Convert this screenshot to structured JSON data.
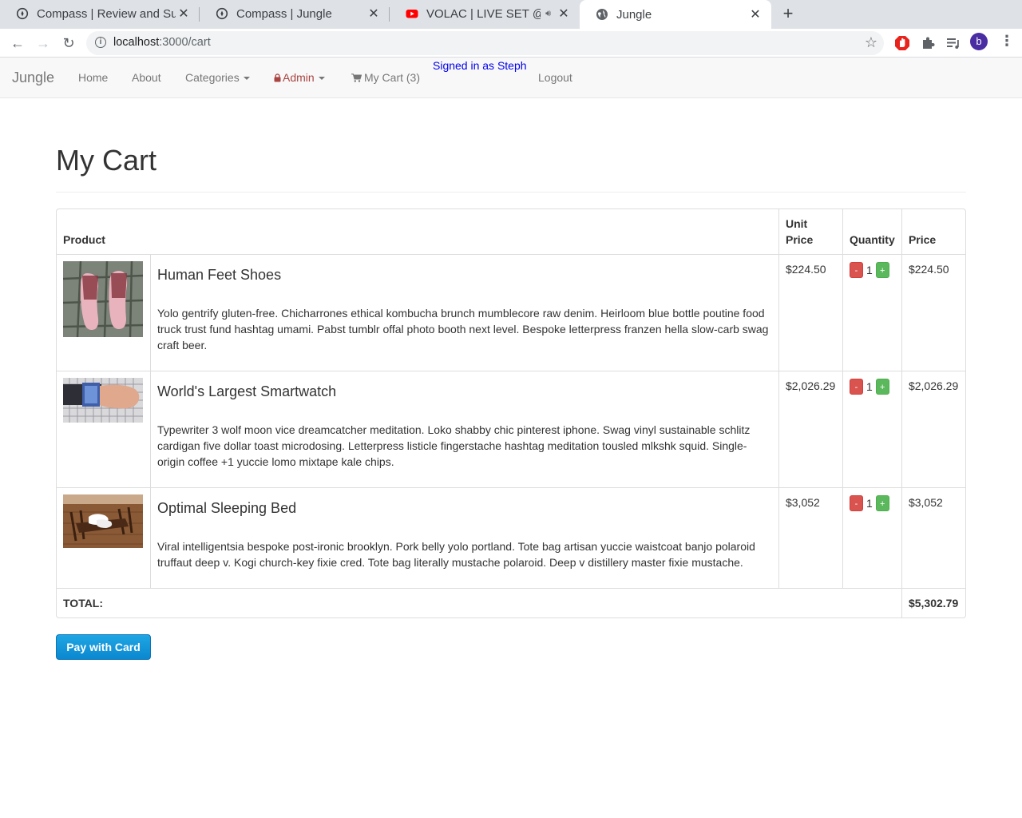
{
  "browser": {
    "tabs": [
      {
        "title": "Compass | Review and Su",
        "active": false
      },
      {
        "title": "Compass | Jungle",
        "active": false
      },
      {
        "title": "VOLAC | LIVE SET @ PA",
        "active": false
      },
      {
        "title": "Jungle",
        "active": true
      }
    ],
    "url_host": "localhost",
    "url_path": ":3000/cart",
    "avatar_letter": "b"
  },
  "nav": {
    "brand": "Jungle",
    "home": "Home",
    "about": "About",
    "categories": "Categories",
    "admin": "Admin",
    "cart": "My Cart (3)",
    "signed_in": "Signed in as Steph",
    "logout": "Logout"
  },
  "page": {
    "title": "My Cart"
  },
  "table": {
    "headers": {
      "product": "Product",
      "unit_price": "Unit Price",
      "quantity": "Quantity",
      "price": "Price"
    },
    "items": [
      {
        "name": "Human Feet Shoes",
        "description": "Yolo gentrify gluten-free. Chicharrones ethical kombucha brunch mumblecore raw denim. Heirloom blue bottle poutine food truck trust fund hashtag umami. Pabst tumblr offal photo booth next level. Bespoke letterpress franzen hella slow-carb swag craft beer.",
        "unit_price": "$224.50",
        "quantity": "1",
        "price": "$224.50"
      },
      {
        "name": "World's Largest Smartwatch",
        "description": "Typewriter 3 wolf moon vice dreamcatcher meditation. Loko shabby chic pinterest iphone. Swag vinyl sustainable schlitz cardigan five dollar toast microdosing. Letterpress listicle fingerstache hashtag meditation tousled mlkshk squid. Single-origin coffee +1 yuccie lomo mixtape kale chips.",
        "unit_price": "$2,026.29",
        "quantity": "1",
        "price": "$2,026.29"
      },
      {
        "name": "Optimal Sleeping Bed",
        "description": "Viral intelligentsia bespoke post-ironic brooklyn. Pork belly yolo portland. Tote bag artisan yuccie waistcoat banjo polaroid truffaut deep v. Kogi church-key fixie cred. Tote bag literally mustache polaroid. Deep v distillery master fixie mustache.",
        "unit_price": "$3,052",
        "quantity": "1",
        "price": "$3,052"
      }
    ],
    "minus_label": "-",
    "plus_label": "+",
    "total_label": "TOTAL:",
    "total_value": "$5,302.79"
  },
  "pay_button": "Pay with Card",
  "colors": {
    "admin_red": "#a94442",
    "btn_danger": "#d9534f",
    "btn_success": "#5cb85c",
    "pay_blue": "#1199dc"
  }
}
